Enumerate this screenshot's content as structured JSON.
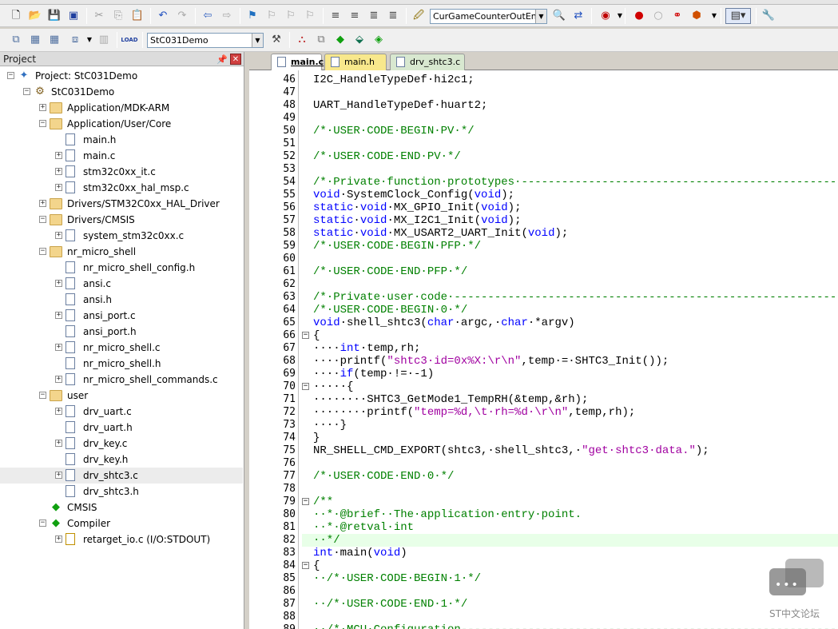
{
  "toolbar1": {
    "target_combo": "CurGameCounterOutEna"
  },
  "toolbar2": {
    "target_combo": "StC031Demo"
  },
  "project_pane": {
    "title": "Project",
    "tree": [
      {
        "label": "Project: StC031Demo",
        "depth": 0,
        "expander": "−",
        "icon": "project-icon"
      },
      {
        "label": "StC031Demo",
        "depth": 1,
        "expander": "−",
        "icon": "target-icon"
      },
      {
        "label": "Application/MDK-ARM",
        "depth": 2,
        "expander": "+",
        "icon": "folder-icon"
      },
      {
        "label": "Application/User/Core",
        "depth": 2,
        "expander": "−",
        "icon": "folder-open-icon"
      },
      {
        "label": "main.h",
        "depth": 3,
        "expander": "",
        "icon": "file-icon"
      },
      {
        "label": "main.c",
        "depth": 3,
        "expander": "+",
        "icon": "file-icon"
      },
      {
        "label": "stm32c0xx_it.c",
        "depth": 3,
        "expander": "+",
        "icon": "file-icon"
      },
      {
        "label": "stm32c0xx_hal_msp.c",
        "depth": 3,
        "expander": "+",
        "icon": "file-icon"
      },
      {
        "label": "Drivers/STM32C0xx_HAL_Driver",
        "depth": 2,
        "expander": "+",
        "icon": "folder-icon"
      },
      {
        "label": "Drivers/CMSIS",
        "depth": 2,
        "expander": "−",
        "icon": "folder-open-icon"
      },
      {
        "label": "system_stm32c0xx.c",
        "depth": 3,
        "expander": "+",
        "icon": "file-icon"
      },
      {
        "label": "nr_micro_shell",
        "depth": 2,
        "expander": "−",
        "icon": "folder-open-icon"
      },
      {
        "label": "nr_micro_shell_config.h",
        "depth": 3,
        "expander": "",
        "icon": "file-icon"
      },
      {
        "label": "ansi.c",
        "depth": 3,
        "expander": "+",
        "icon": "file-icon"
      },
      {
        "label": "ansi.h",
        "depth": 3,
        "expander": "",
        "icon": "file-icon"
      },
      {
        "label": "ansi_port.c",
        "depth": 3,
        "expander": "+",
        "icon": "file-icon"
      },
      {
        "label": "ansi_port.h",
        "depth": 3,
        "expander": "",
        "icon": "file-icon"
      },
      {
        "label": "nr_micro_shell.c",
        "depth": 3,
        "expander": "+",
        "icon": "file-icon"
      },
      {
        "label": "nr_micro_shell.h",
        "depth": 3,
        "expander": "",
        "icon": "file-icon"
      },
      {
        "label": "nr_micro_shell_commands.c",
        "depth": 3,
        "expander": "+",
        "icon": "file-icon"
      },
      {
        "label": "user",
        "depth": 2,
        "expander": "−",
        "icon": "folder-open-icon"
      },
      {
        "label": "drv_uart.c",
        "depth": 3,
        "expander": "+",
        "icon": "file-icon"
      },
      {
        "label": "drv_uart.h",
        "depth": 3,
        "expander": "",
        "icon": "file-icon"
      },
      {
        "label": "drv_key.c",
        "depth": 3,
        "expander": "+",
        "icon": "file-icon"
      },
      {
        "label": "drv_key.h",
        "depth": 3,
        "expander": "",
        "icon": "file-icon"
      },
      {
        "label": "drv_shtc3.c",
        "depth": 3,
        "expander": "+",
        "icon": "file-icon",
        "selected": true
      },
      {
        "label": "drv_shtc3.h",
        "depth": 3,
        "expander": "",
        "icon": "file-icon"
      },
      {
        "label": "CMSIS",
        "depth": 2,
        "expander": "",
        "icon": "component-icon"
      },
      {
        "label": "Compiler",
        "depth": 2,
        "expander": "−",
        "icon": "component-icon"
      },
      {
        "label": "retarget_io.c (I/O:STDOUT)",
        "depth": 3,
        "expander": "+",
        "icon": "key-file-icon"
      }
    ]
  },
  "tabs": [
    {
      "label": "main.c",
      "active": true
    },
    {
      "label": "main.h",
      "active": false
    },
    {
      "label": "drv_shtc3.c",
      "active": false
    }
  ],
  "colors": {
    "keyword": "#0000ff",
    "comment": "#008000",
    "string": "#a000a0",
    "text": "#000000"
  },
  "editor": {
    "lines": [
      {
        "n": "46",
        "seg": [
          [
            "t",
            "I2C_HandleTypeDef·hi2c1;"
          ]
        ]
      },
      {
        "n": "47",
        "seg": []
      },
      {
        "n": "48",
        "seg": [
          [
            "t",
            "UART_HandleTypeDef·huart2;"
          ]
        ]
      },
      {
        "n": "49",
        "seg": []
      },
      {
        "n": "50",
        "seg": [
          [
            "c",
            "/*·USER·CODE·BEGIN·PV·*/"
          ]
        ]
      },
      {
        "n": "51",
        "seg": []
      },
      {
        "n": "52",
        "seg": [
          [
            "c",
            "/*·USER·CODE·END·PV·*/"
          ]
        ]
      },
      {
        "n": "53",
        "seg": []
      },
      {
        "n": "54",
        "seg": [
          [
            "c",
            "/*·Private·function·prototypes·-----------------------------------------------*/"
          ]
        ]
      },
      {
        "n": "55",
        "seg": [
          [
            "k",
            "void"
          ],
          [
            "t",
            "·SystemClock_Config("
          ],
          [
            "k",
            "void"
          ],
          [
            "t",
            ");"
          ]
        ]
      },
      {
        "n": "56",
        "seg": [
          [
            "k",
            "static"
          ],
          [
            "t",
            "·"
          ],
          [
            "k",
            "void"
          ],
          [
            "t",
            "·MX_GPIO_Init("
          ],
          [
            "k",
            "void"
          ],
          [
            "t",
            ");"
          ]
        ]
      },
      {
        "n": "57",
        "seg": [
          [
            "k",
            "static"
          ],
          [
            "t",
            "·"
          ],
          [
            "k",
            "void"
          ],
          [
            "t",
            "·MX_I2C1_Init("
          ],
          [
            "k",
            "void"
          ],
          [
            "t",
            ");"
          ]
        ]
      },
      {
        "n": "58",
        "seg": [
          [
            "k",
            "static"
          ],
          [
            "t",
            "·"
          ],
          [
            "k",
            "void"
          ],
          [
            "t",
            "·MX_USART2_UART_Init("
          ],
          [
            "k",
            "void"
          ],
          [
            "t",
            ");"
          ]
        ]
      },
      {
        "n": "59",
        "seg": [
          [
            "c",
            "/*·USER·CODE·BEGIN·PFP·*/"
          ]
        ]
      },
      {
        "n": "60",
        "seg": []
      },
      {
        "n": "61",
        "seg": [
          [
            "c",
            "/*·USER·CODE·END·PFP·*/"
          ]
        ]
      },
      {
        "n": "62",
        "seg": []
      },
      {
        "n": "63",
        "seg": [
          [
            "c",
            "/*·Private·user·code·---------------------------------------------------------*/"
          ]
        ]
      },
      {
        "n": "64",
        "seg": [
          [
            "c",
            "/*·USER·CODE·BEGIN·0·*/"
          ]
        ]
      },
      {
        "n": "65",
        "seg": [
          [
            "k",
            "void"
          ],
          [
            "t",
            "·shell_shtc3("
          ],
          [
            "k",
            "char"
          ],
          [
            "t",
            "·argc,·"
          ],
          [
            "k",
            "char"
          ],
          [
            "t",
            "·*argv)"
          ]
        ]
      },
      {
        "n": "66",
        "fold": "−",
        "seg": [
          [
            "t",
            "{"
          ]
        ]
      },
      {
        "n": "67",
        "seg": [
          [
            "t",
            "····"
          ],
          [
            "k",
            "int"
          ],
          [
            "t",
            "·temp,rh;"
          ]
        ]
      },
      {
        "n": "68",
        "seg": [
          [
            "t",
            "····printf("
          ],
          [
            "s",
            "\"shtc3·id=0x%X:\\r\\n\""
          ],
          [
            "t",
            ",temp·=·SHTC3_Init());"
          ]
        ]
      },
      {
        "n": "69",
        "seg": [
          [
            "t",
            "····"
          ],
          [
            "k",
            "if"
          ],
          [
            "t",
            "(temp·!=·-1)"
          ]
        ]
      },
      {
        "n": "70",
        "fold": "−",
        "seg": [
          [
            "t",
            "·····{"
          ]
        ]
      },
      {
        "n": "71",
        "seg": [
          [
            "t",
            "········SHTC3_GetMode1_TempRH(&temp,&rh);"
          ]
        ]
      },
      {
        "n": "72",
        "seg": [
          [
            "t",
            "········printf("
          ],
          [
            "s",
            "\"temp=%d,\\t·rh=%d·\\r\\n\""
          ],
          [
            "t",
            ",temp,rh);"
          ]
        ]
      },
      {
        "n": "73",
        "seg": [
          [
            "t",
            "····}"
          ]
        ]
      },
      {
        "n": "74",
        "seg": [
          [
            "t",
            "}"
          ]
        ]
      },
      {
        "n": "75",
        "seg": [
          [
            "t",
            "NR_SHELL_CMD_EXPORT(shtc3,·shell_shtc3,·"
          ],
          [
            "s",
            "\"get·shtc3·data.\""
          ],
          [
            "t",
            ");"
          ]
        ]
      },
      {
        "n": "76",
        "seg": []
      },
      {
        "n": "77",
        "seg": [
          [
            "c",
            "/*·USER·CODE·END·0·*/"
          ]
        ]
      },
      {
        "n": "78",
        "seg": []
      },
      {
        "n": "79",
        "fold": "−",
        "seg": [
          [
            "c",
            "/**"
          ]
        ]
      },
      {
        "n": "80",
        "seg": [
          [
            "c",
            "··*·@brief··The·application·entry·point."
          ]
        ]
      },
      {
        "n": "81",
        "seg": [
          [
            "c",
            "··*·@retval·int"
          ]
        ]
      },
      {
        "n": "82",
        "current": true,
        "seg": [
          [
            "c",
            "··*/"
          ]
        ]
      },
      {
        "n": "83",
        "seg": [
          [
            "k",
            "int"
          ],
          [
            "t",
            "·main("
          ],
          [
            "k",
            "void"
          ],
          [
            "t",
            ")"
          ]
        ]
      },
      {
        "n": "84",
        "fold": "−",
        "seg": [
          [
            "t",
            "{"
          ]
        ]
      },
      {
        "n": "85",
        "seg": [
          [
            "c",
            "··/*·USER·CODE·BEGIN·1·*/"
          ]
        ]
      },
      {
        "n": "86",
        "seg": []
      },
      {
        "n": "87",
        "seg": [
          [
            "c",
            "··/*·USER·CODE·END·1·*/"
          ]
        ]
      },
      {
        "n": "88",
        "seg": []
      },
      {
        "n": "89",
        "seg": [
          [
            "c",
            "··/*·MCU·Configuration--------------------------------------------------------*/"
          ]
        ]
      }
    ]
  },
  "watermark": {
    "text": "ST中文论坛"
  }
}
